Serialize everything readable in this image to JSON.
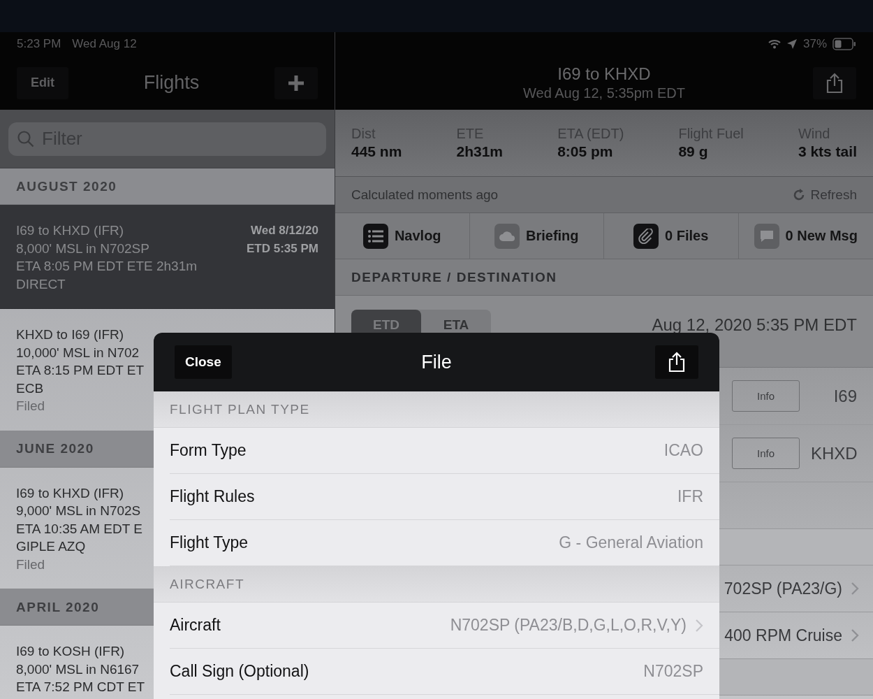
{
  "status_bar": {
    "time": "5:23 PM",
    "date": "Wed Aug 12",
    "battery": "37%"
  },
  "flights_pane": {
    "edit_button": "Edit",
    "title": "Flights",
    "filter": {
      "placeholder": "Filter"
    },
    "sections": [
      {
        "heading": "AUGUST 2020",
        "flights": [
          {
            "lines": [
              "I69 to KHXD (IFR)",
              "8,000' MSL in N702SP",
              "ETA 8:05 PM EDT ETE 2h31m",
              "DIRECT"
            ],
            "date": "Wed 8/12/20",
            "etd": "ETD 5:35 PM",
            "selected": true
          },
          {
            "lines": [
              "KHXD to I69 (IFR)",
              "10,000' MSL in N702",
              "ETA 8:15 PM EDT ET",
              "ECB"
            ],
            "status": "Filed",
            "selected": false
          }
        ]
      },
      {
        "heading": "JUNE 2020",
        "flights": [
          {
            "lines": [
              "I69 to KHXD (IFR)",
              "9,000' MSL in N702S",
              "ETA 10:35 AM EDT E",
              "GIPLE AZQ"
            ],
            "status": "Filed",
            "selected": false
          }
        ]
      },
      {
        "heading": "APRIL 2020",
        "flights": [
          {
            "lines": [
              "I69 to KOSH (IFR)",
              "8,000' MSL in N6167",
              "ETA 7:52 PM CDT ET"
            ],
            "selected": false
          }
        ]
      }
    ]
  },
  "detail": {
    "title": "I69 to KHXD",
    "subtitle": "Wed Aug 12, 5:35pm EDT",
    "stats": [
      {
        "label": "Dist",
        "value": "445 nm"
      },
      {
        "label": "ETE",
        "value": "2h31m"
      },
      {
        "label": "ETA (EDT)",
        "value": "8:05 pm"
      },
      {
        "label": "Flight Fuel",
        "value": "89 g"
      },
      {
        "label": "Wind",
        "value": "3 kts tail"
      }
    ],
    "calculated": "Calculated moments ago",
    "refresh": "Refresh",
    "actions": [
      {
        "kind": "navlog",
        "label": "Navlog",
        "enabled": true
      },
      {
        "kind": "briefing",
        "label": "Briefing",
        "enabled": false
      },
      {
        "kind": "files",
        "label": "0 Files",
        "enabled": true
      },
      {
        "kind": "messages",
        "label": "0 New Msg",
        "enabled": false
      }
    ],
    "section": "DEPARTURE / DESTINATION",
    "time_mode": [
      {
        "label": "ETD",
        "selected": true
      },
      {
        "label": "ETA",
        "selected": false
      }
    ],
    "time_value": "Aug 12, 2020 5:35 PM EDT",
    "rows": [
      {
        "kind": "info",
        "button": "Info",
        "value": "I69"
      },
      {
        "kind": "info",
        "button": "Info",
        "value": "KHXD"
      },
      {
        "kind": "empty"
      },
      {
        "kind": "section"
      },
      {
        "kind": "link",
        "value": "702SP (PA23/G)"
      },
      {
        "kind": "link",
        "value": "400 RPM Cruise"
      },
      {
        "kind": "section"
      },
      {
        "kind": "empty"
      }
    ]
  },
  "modal": {
    "close": "Close",
    "title": "File",
    "sections": [
      {
        "heading": "FLIGHT PLAN TYPE",
        "rows": [
          {
            "label": "Form Type",
            "value": "ICAO",
            "chevron": false
          },
          {
            "label": "Flight Rules",
            "value": "IFR",
            "chevron": false
          },
          {
            "label": "Flight Type",
            "value": "G - General Aviation",
            "chevron": false
          }
        ]
      },
      {
        "heading": "AIRCRAFT",
        "rows": [
          {
            "label": "Aircraft",
            "value": "N702SP (PA23/B,D,G,L,O,R,V,Y)",
            "chevron": true
          },
          {
            "label": "Call Sign (Optional)",
            "value": "N702SP",
            "chevron": false
          }
        ]
      }
    ]
  }
}
